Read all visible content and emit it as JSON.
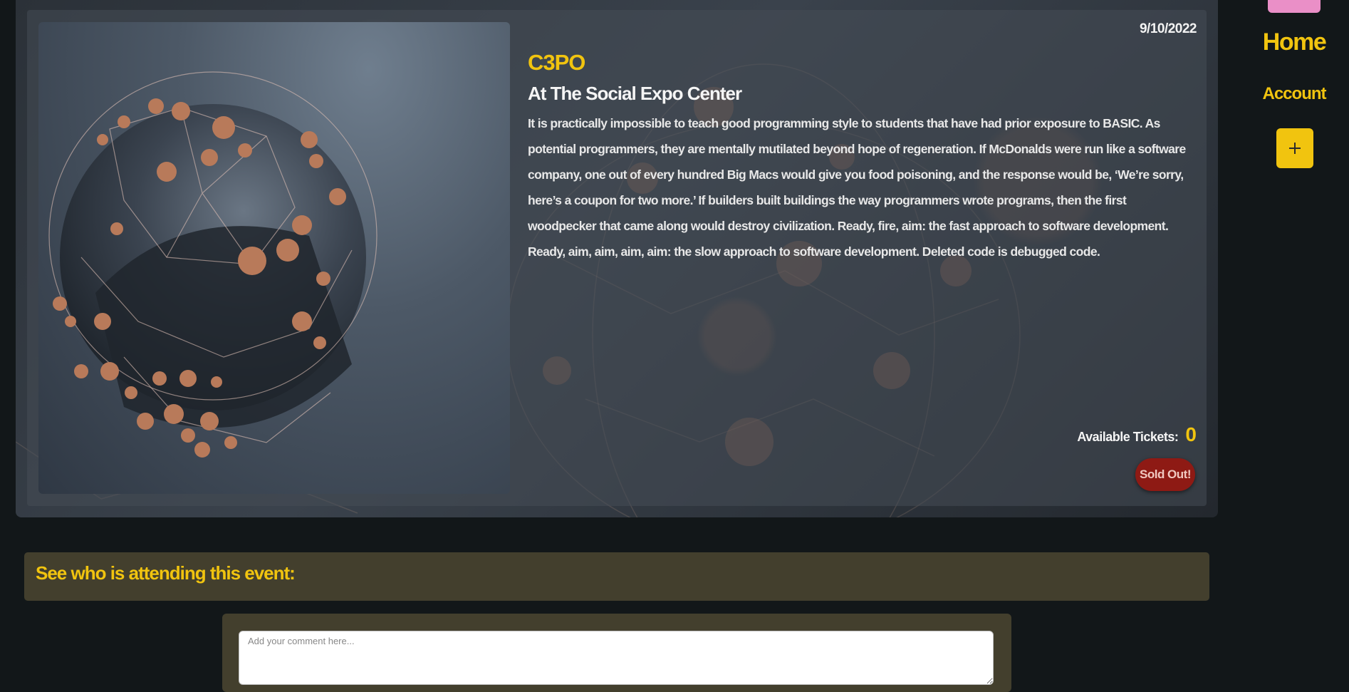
{
  "event": {
    "date": "9/10/2022",
    "title": "C3PO",
    "venue": "At The Social Expo Center",
    "description": "It is practically impossible to teach good programming style to students that have had prior exposure to BASIC. As potential programmers, they are mentally mutilated beyond hope of regeneration. If McDonalds were run like a software company, one out of every hundred Big Macs would give you food poisoning, and the response would be, ‘We’re sorry, here’s a coupon for two more.’ If builders built buildings the way programmers wrote programs, then the first woodpecker that came along would destroy civilization. Ready, fire, aim: the fast approach to software development. Ready, aim, aim, aim, aim: the slow approach to software development. Deleted code is debugged code.",
    "tickets_label": "Available Tickets:",
    "tickets_count": "0",
    "status_badge": "Sold Out!"
  },
  "nav": {
    "home": "Home",
    "account": "Account",
    "add_icon": "plus-icon"
  },
  "attendees": {
    "title": "See who is attending this event:"
  },
  "comment": {
    "placeholder": "Add your comment here..."
  },
  "colors": {
    "accent": "#f1c40f",
    "badge": "#8e1a14",
    "panel": "#433f2d",
    "page_bg": "#121719",
    "nav_pill": "#ea8fc7"
  }
}
